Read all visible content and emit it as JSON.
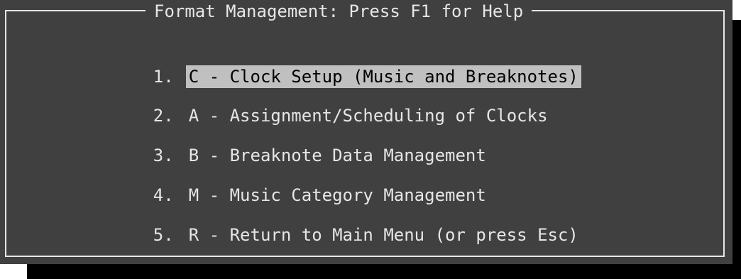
{
  "dialog": {
    "title": "Format Management: Press F1 for Help"
  },
  "menu": {
    "items": [
      {
        "number": "1.",
        "label": "C - Clock Setup (Music and Breaknotes)"
      },
      {
        "number": "2.",
        "label": "A - Assignment/Scheduling of Clocks"
      },
      {
        "number": "3.",
        "label": "B - Breaknote Data Management"
      },
      {
        "number": "4.",
        "label": "M - Music Category Management"
      },
      {
        "number": "5.",
        "label": "R - Return to Main Menu (or press Esc)"
      }
    ],
    "selected_index": 0
  },
  "colors": {
    "background": "#404040",
    "text": "#e6e6e6",
    "highlight_bg": "#c0c0c0",
    "highlight_text": "#000000",
    "shadow": "#000000"
  }
}
